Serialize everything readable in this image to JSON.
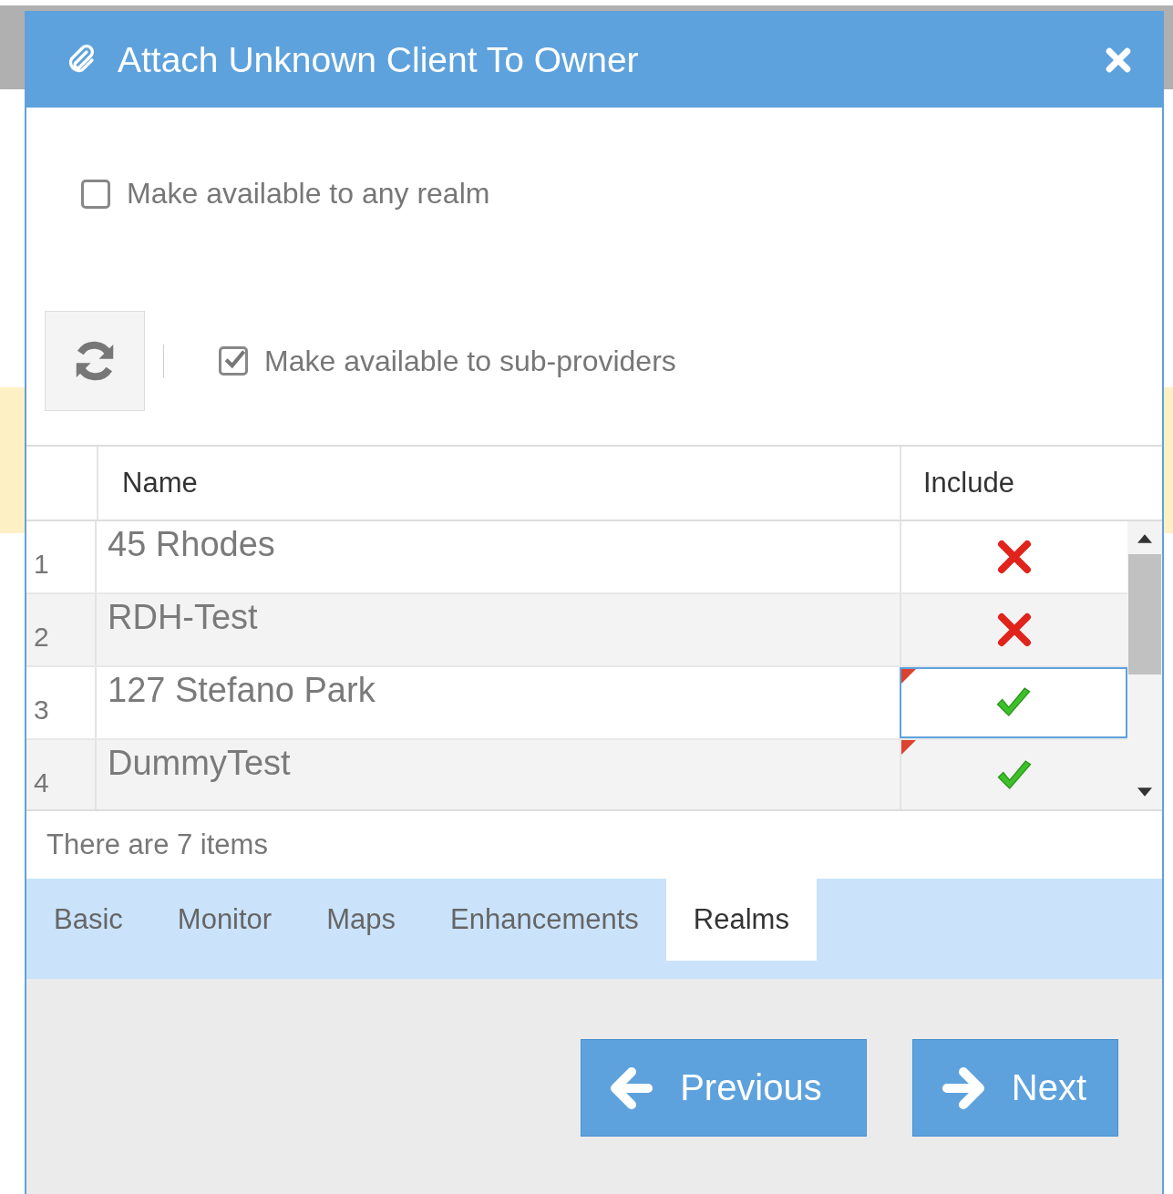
{
  "dialog": {
    "title": "Attach Unknown Client To Owner"
  },
  "any_realm": {
    "label": "Make available to any realm",
    "checked": false
  },
  "sub_providers": {
    "label": "Make available to sub-providers",
    "checked": true
  },
  "table": {
    "columns": [
      "Name",
      "Include"
    ],
    "rows": [
      {
        "number": "1",
        "name": "45 Rhodes",
        "include": false,
        "modified": false,
        "selected": false
      },
      {
        "number": "2",
        "name": "RDH-Test",
        "include": false,
        "modified": false,
        "selected": false
      },
      {
        "number": "3",
        "name": "127 Stefano Park",
        "include": true,
        "modified": true,
        "selected": true
      },
      {
        "number": "4",
        "name": "DummyTest",
        "include": true,
        "modified": true,
        "selected": false
      }
    ]
  },
  "footer": "There are 7 items",
  "tabs": [
    {
      "label": "Basic",
      "selected": false
    },
    {
      "label": "Monitor",
      "selected": false
    },
    {
      "label": "Maps",
      "selected": false
    },
    {
      "label": "Enhancements",
      "selected": false
    },
    {
      "label": "Realms",
      "selected": true
    }
  ],
  "buttons": [
    {
      "kind": "previous",
      "label": "Previous"
    },
    {
      "kind": "next",
      "label": "Next"
    }
  ]
}
